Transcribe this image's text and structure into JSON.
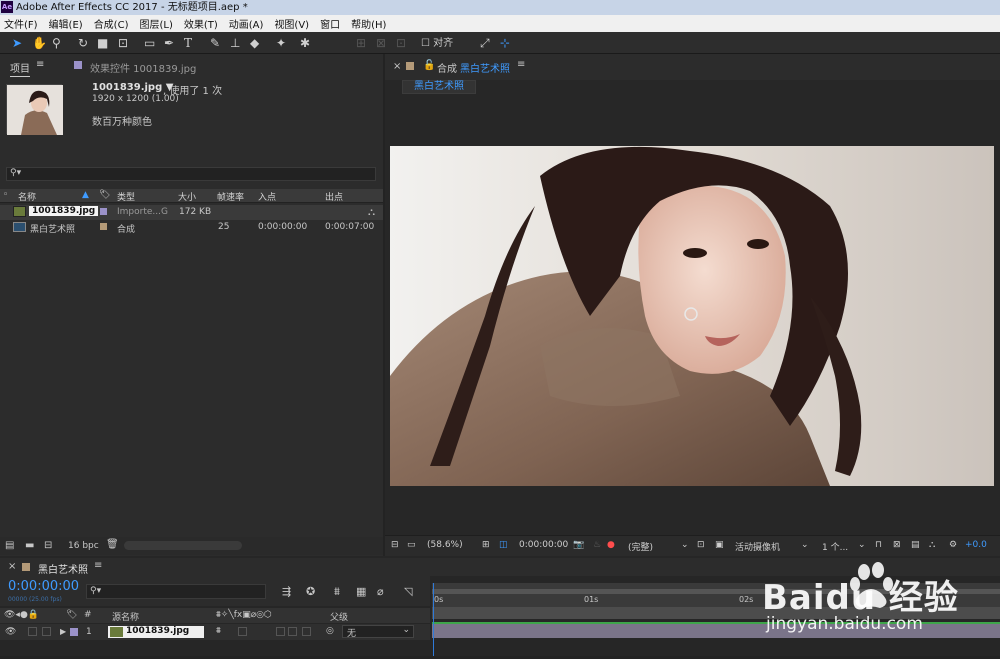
{
  "window": {
    "title": "Adobe After Effects CC 2017 - 无标题项目.aep *"
  },
  "menu": [
    "文件(F)",
    "编辑(E)",
    "合成(C)",
    "图层(L)",
    "效果(T)",
    "动画(A)",
    "视图(V)",
    "窗口",
    "帮助(H)"
  ],
  "toolbar": {
    "align_label": "对齐"
  },
  "project": {
    "tab_label": "项目",
    "effects_tab_label": "效果控件 1001839.jpg",
    "selected_name": "1001839.jpg ▼",
    "used_text": ", 使用了 1 次",
    "dimensions": "1920 x 1200 (1.00)",
    "color_info": "数百万种颜色",
    "columns": {
      "name": "名称",
      "type": "类型",
      "size": "大小",
      "fps": "帧速率",
      "in": "入点",
      "out": "出点"
    },
    "items": [
      {
        "name": "1001839.jpg",
        "type": "Importe...G",
        "size": "172 KB",
        "fps": "",
        "in": "",
        "out": ""
      },
      {
        "name": "黑白艺术照",
        "type": "合成",
        "size": "",
        "fps": "25",
        "in": "0:00:00:00",
        "out": "0:00:07:00"
      }
    ],
    "bpc": "16 bpc"
  },
  "comp": {
    "tab_prefix": "合成",
    "tab_name": "黑白艺术照",
    "sub_tab": "黑白艺术照",
    "zoom": "(58.6%)",
    "timecode": "0:00:00:00",
    "quality": "(完整)",
    "camera": "活动摄像机",
    "views": "1 个...",
    "exposure": "+0.0"
  },
  "timeline": {
    "tab_name": "黑白艺术照",
    "timecode": "0:00:00:00",
    "timecode_sub": "00000 (25.00 fps)",
    "ruler": [
      "0s",
      "01s",
      "02s"
    ],
    "columns": {
      "source_name": "源名称",
      "parent": "父级"
    },
    "layer": {
      "num": "1",
      "name": "1001839.jpg",
      "parent": "无"
    }
  },
  "watermark": {
    "brand": "Baidu 经验",
    "url": "jingyan.baidu.com"
  },
  "colors": {
    "accent_blue": "#3f9bff",
    "label_lavender": "#9b92c9",
    "label_tan": "#b49a78"
  }
}
